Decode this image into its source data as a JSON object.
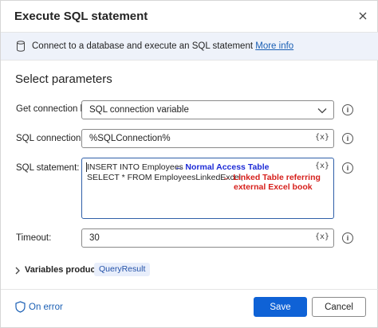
{
  "dialog": {
    "title": "Execute SQL statement",
    "close_icon": "close-icon"
  },
  "info": {
    "icon": "database-icon",
    "text": "Connect to a database and execute an SQL statement",
    "link": "More info"
  },
  "section_title": "Select parameters",
  "fields": {
    "get_connection": {
      "label": "Get connection by:",
      "value": "SQL connection variable"
    },
    "sql_connection": {
      "label": "SQL connection:",
      "value": "%SQLConnection%",
      "var_button": "{x}"
    },
    "sql_statement": {
      "label": "SQL statement:",
      "line1": "INSERT INTO Employees",
      "line2": "SELECT * FROM EmployeesLinkedExcel;",
      "var_button": "{x}",
      "annotation_blue": "← Normal Access Table",
      "annotation_red_1": "← Linked Table referring",
      "annotation_red_2": "external Excel book"
    },
    "timeout": {
      "label": "Timeout:",
      "value": "30",
      "var_button": "{x}"
    }
  },
  "help_icon_glyph": "i",
  "variables": {
    "label": "Variables produced",
    "items": [
      "QueryResult"
    ]
  },
  "footer": {
    "on_error": "On error",
    "save": "Save",
    "cancel": "Cancel"
  },
  "colors": {
    "accent": "#0f62d6",
    "link": "#1a5fb4",
    "annotation_blue": "#1d2bd6",
    "annotation_red": "#d6201c",
    "info_bar": "#eef2fa"
  }
}
